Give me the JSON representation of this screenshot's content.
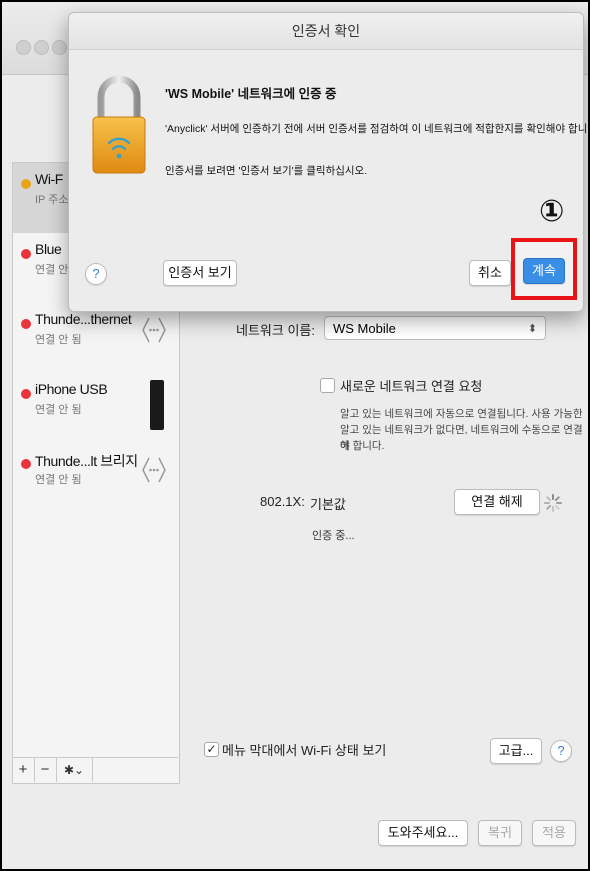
{
  "dialog": {
    "title": "인증서 확인",
    "heading": "'WS Mobile' 네트워크에 인증 중",
    "message": "'Anyclick' 서버에 인증하기 전에 서버 인증서를 점검하여 이 네트워크에 적합한지를 확인해야 합니다.",
    "hint": "인증서를 보려면 '인증서 보기'를 클릭하십시오.",
    "help": "?",
    "show_cert_label": "인증서 보기",
    "cancel_label": "취소",
    "continue_label": "계속",
    "step_marker": "①"
  },
  "sidebar": {
    "items": [
      {
        "name": "Wi-F",
        "status": "IP 주소",
        "dot": "#e8a317"
      },
      {
        "name": "Blue",
        "status": "연결 안",
        "dot": "#e8343b"
      },
      {
        "name": "Thunde...thernet",
        "status": "연결 안 됨",
        "dot": "#e8343b"
      },
      {
        "name": "iPhone USB",
        "status": "연결 안 됨",
        "dot": "#e8343b"
      },
      {
        "name": "Thunde...lt 브리지",
        "status": "연결 안 됨",
        "dot": "#e8343b"
      }
    ],
    "add": "+",
    "remove": "−",
    "gear": "✱⌄"
  },
  "main": {
    "network_name_label": "네트워크 이름:",
    "network_name_value": "WS Mobile",
    "ask_join_label": "새로운 네트워크 연결 요청",
    "ask_join_desc_1": "알고 있는 네트워크에 자동으로 연결됩니다. 사용 가능한",
    "ask_join_desc_2": "알고 있는 네트워크가 없다면, 네트워크에 수동으로 연결해",
    "ask_join_desc_3": "야 합니다.",
    "dot1x_label": "802.1X:",
    "dot1x_value": "기본값",
    "disconnect_label": "연결 해제",
    "auth_status": "인증 중...",
    "show_wifi_check": "✓",
    "show_wifi_label": "메뉴 막대에서 Wi-Fi 상태 보기",
    "advanced_label": "고급...",
    "help": "?"
  },
  "footer": {
    "assist_label": "도와주세요...",
    "revert_label": "복귀",
    "apply_label": "적용"
  },
  "colors": {
    "accent": "#3a8ee6",
    "highlight": "#e8141a",
    "lock": "#f0a020"
  }
}
